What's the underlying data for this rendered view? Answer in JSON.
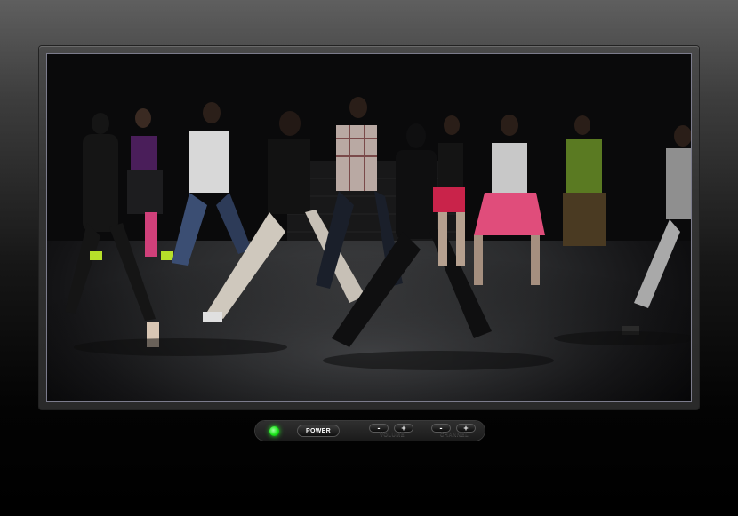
{
  "window": {
    "type": "tv-player"
  },
  "screen": {
    "content": "video-frame",
    "colors": {
      "floor": "#2f3032",
      "wall": "#0b0b0c",
      "bezel": "#3a3a3a"
    }
  },
  "controls": {
    "power_label": "POWER",
    "power_led_color": "#19e619",
    "volume": {
      "label": "VOLUME",
      "down": "-",
      "up": "+"
    },
    "channel": {
      "label": "CHANNEL",
      "down": "-",
      "up": "+"
    }
  }
}
